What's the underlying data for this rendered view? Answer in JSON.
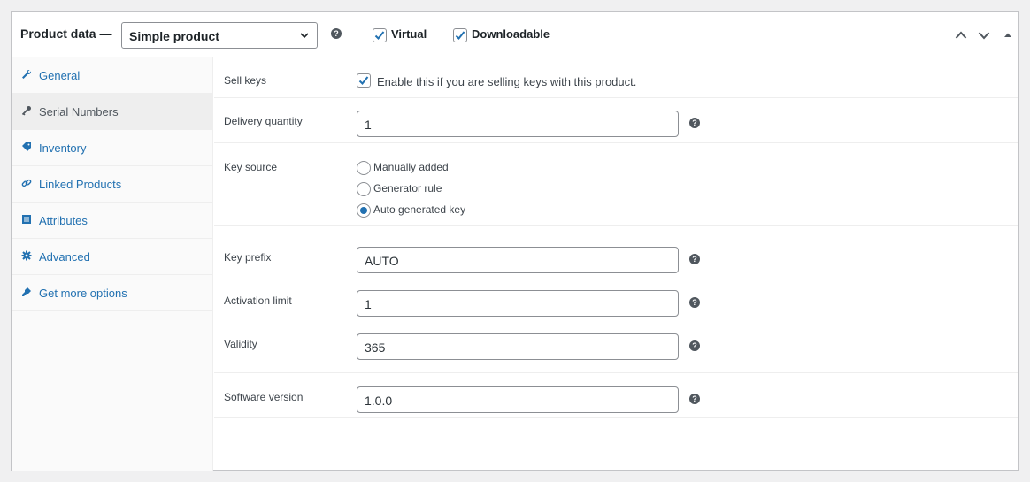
{
  "header": {
    "title": "Product data —",
    "product_type": "Simple product",
    "virtual_label": "Virtual",
    "virtual_checked": true,
    "downloadable_label": "Downloadable",
    "downloadable_checked": true,
    "help_glyph": "?"
  },
  "tabs": [
    {
      "label": "General",
      "icon": "wrench-icon",
      "active": false
    },
    {
      "label": "Serial Numbers",
      "icon": "key-icon",
      "active": true
    },
    {
      "label": "Inventory",
      "icon": "tag-icon",
      "active": false
    },
    {
      "label": "Linked Products",
      "icon": "link-icon",
      "active": false
    },
    {
      "label": "Attributes",
      "icon": "list-icon",
      "active": false
    },
    {
      "label": "Advanced",
      "icon": "gear-icon",
      "active": false
    },
    {
      "label": "Get more options",
      "icon": "plugin-icon",
      "active": false
    }
  ],
  "fields": {
    "sell_keys": {
      "label": "Sell keys",
      "description": "Enable this if you are selling keys with this product.",
      "checked": true
    },
    "delivery_quantity": {
      "label": "Delivery quantity",
      "value": "1"
    },
    "key_source": {
      "label": "Key source",
      "options": [
        "Manually added",
        "Generator rule",
        "Auto generated key"
      ],
      "selected": "Auto generated key"
    },
    "key_prefix": {
      "label": "Key prefix",
      "value": "AUTO"
    },
    "activation_limit": {
      "label": "Activation limit",
      "value": "1"
    },
    "validity": {
      "label": "Validity",
      "value": "365"
    },
    "software_version": {
      "label": "Software version",
      "value": "1.0.0"
    }
  },
  "colors": {
    "link": "#2271b1",
    "border": "#c3c4c7",
    "help": "#50575e"
  }
}
